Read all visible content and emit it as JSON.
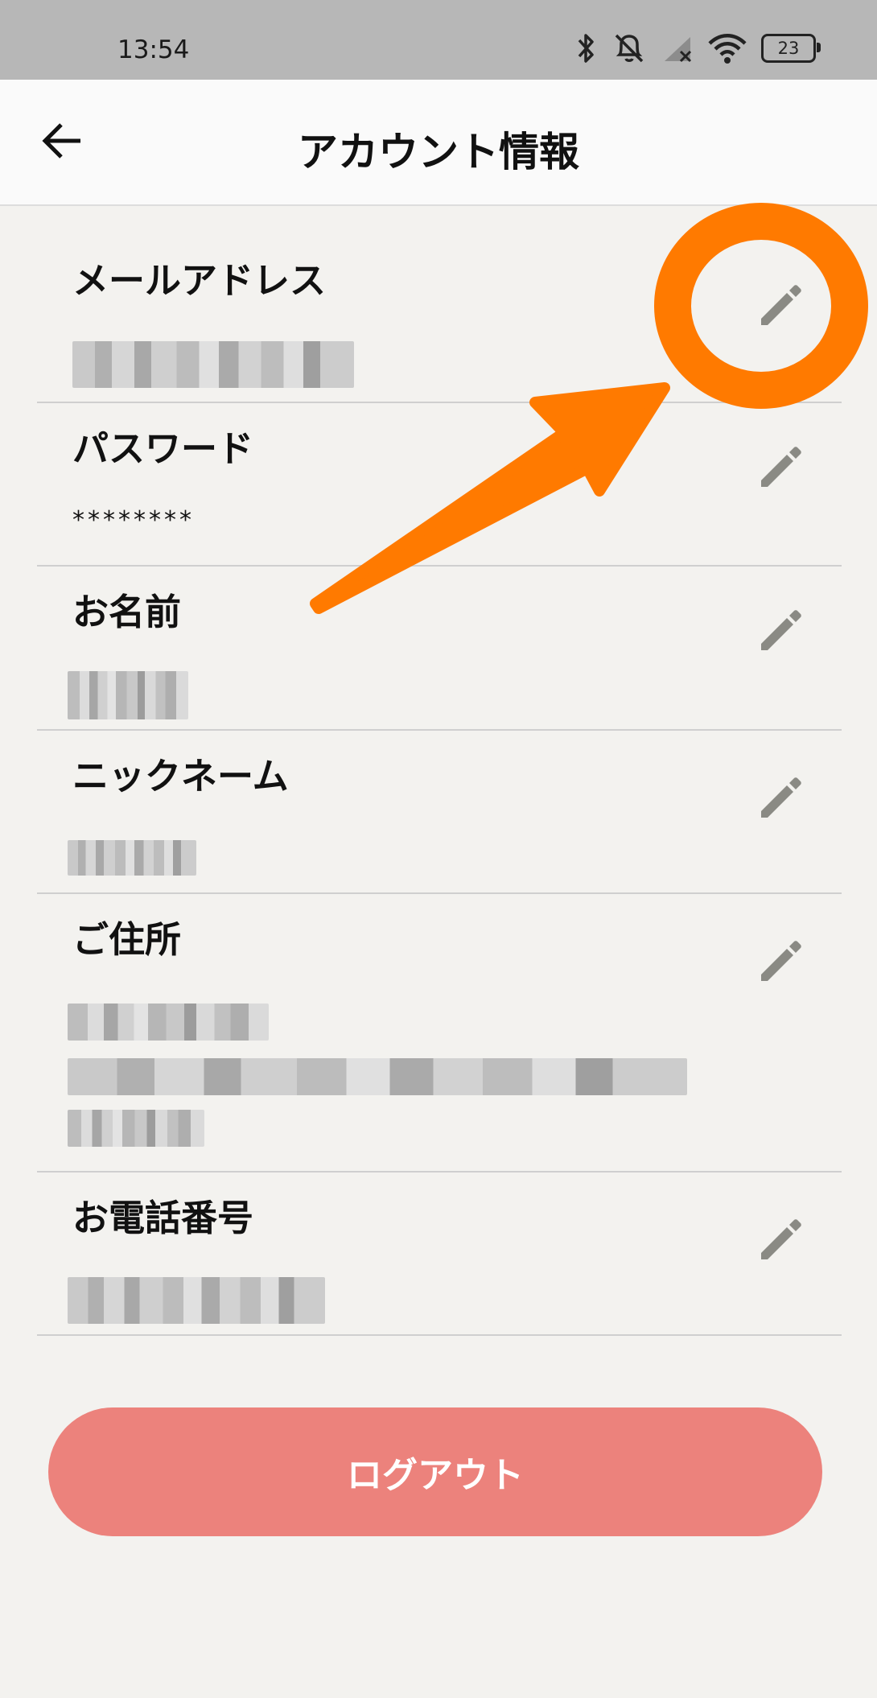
{
  "status_bar": {
    "time": "13:54",
    "battery": "23",
    "icons": [
      "bluetooth-icon",
      "mute-icon",
      "signal-icon",
      "wifi-icon",
      "battery-icon"
    ]
  },
  "header": {
    "title": "アカウント情報",
    "back_icon": "arrow-left-icon"
  },
  "fields": [
    {
      "label": "メールアドレス",
      "value": "",
      "masked": true,
      "edit_icon": "pencil-icon"
    },
    {
      "label": "パスワード",
      "value": "********",
      "masked": false,
      "edit_icon": "pencil-icon"
    },
    {
      "label": "お名前",
      "value": "",
      "masked": true,
      "edit_icon": "pencil-icon"
    },
    {
      "label": "ニックネーム",
      "value": "",
      "masked": true,
      "edit_icon": "pencil-icon"
    },
    {
      "label": "ご住所",
      "value": "",
      "masked": true,
      "edit_icon": "pencil-icon"
    },
    {
      "label": "お電話番号",
      "value": "",
      "masked": true,
      "edit_icon": "pencil-icon"
    }
  ],
  "logout_button": {
    "label": "ログアウト"
  },
  "colors": {
    "status_bar": "#b7b7b7",
    "background": "#f3f2ef",
    "header": "#fafafa",
    "logout_button": "#ec827c",
    "annotation": "#ff7a00",
    "edit_icon": "#8a8a84"
  }
}
